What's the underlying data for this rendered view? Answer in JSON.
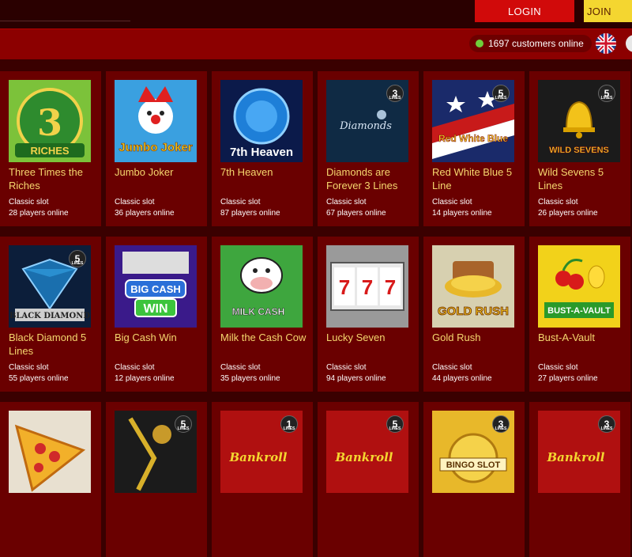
{
  "header": {
    "login_label": "LOGIN",
    "join_label": "JOIN",
    "customers_online": "1697 customers online",
    "language_icon": "uk-flag-icon"
  },
  "colors": {
    "accent_red": "#d10a0a",
    "join_yellow": "#f4d630",
    "title_gold": "#f5d76e",
    "card_bg": "#6a0000"
  },
  "games": [
    {
      "title": "Three Times the Riches",
      "type": "Classic slot",
      "players": "28 players online",
      "badge": ""
    },
    {
      "title": "Jumbo Joker",
      "type": "Classic slot",
      "players": "36 players online",
      "badge": ""
    },
    {
      "title": "7th Heaven",
      "type": "Classic slot",
      "players": "87 players online",
      "badge": ""
    },
    {
      "title": "Diamonds are Forever 3 Lines",
      "type": "Classic slot",
      "players": "67 players online",
      "badge": "3"
    },
    {
      "title": "Red White Blue 5 Line",
      "type": "Classic slot",
      "players": "14 players online",
      "badge": "5"
    },
    {
      "title": "Wild Sevens 5 Lines",
      "type": "Classic slot",
      "players": "26 players online",
      "badge": "5"
    },
    {
      "title": "Black Diamond 5 Lines",
      "type": "Classic slot",
      "players": "55 players online",
      "badge": "5"
    },
    {
      "title": "Big Cash Win",
      "type": "Classic slot",
      "players": "12 players online",
      "badge": ""
    },
    {
      "title": "Milk the Cash Cow",
      "type": "Classic slot",
      "players": "35 players online",
      "badge": ""
    },
    {
      "title": "Lucky Seven",
      "type": "Classic slot",
      "players": "94 players online",
      "badge": ""
    },
    {
      "title": "Gold Rush",
      "type": "Classic slot",
      "players": "44 players online",
      "badge": ""
    },
    {
      "title": "Bust-A-Vault",
      "type": "Classic slot",
      "players": "27 players online",
      "badge": ""
    }
  ],
  "partial_row_badges": [
    "",
    "5",
    "1",
    "5",
    "3",
    "3"
  ],
  "thumb_texts": {
    "three_times": "RICHES",
    "jumbo_joker": "Jumbo Joker",
    "seventh_heaven": "7th Heaven",
    "diamonds": "Diamonds",
    "red_white_blue": "Red White Blue",
    "wild_sevens": "WILD SEVENS",
    "black_diamond": "BLACK DIAMOND",
    "big_cash_win_1": "BIG CASH",
    "big_cash_win_2": "WIN",
    "milk_cash": "MILK CASH",
    "gold_rush": "GOLD RUSH",
    "bust_a_vault": "BUST-A-VAULT",
    "bankroll": "Bankroll",
    "bingo_slot": "BINGO SLOT"
  }
}
